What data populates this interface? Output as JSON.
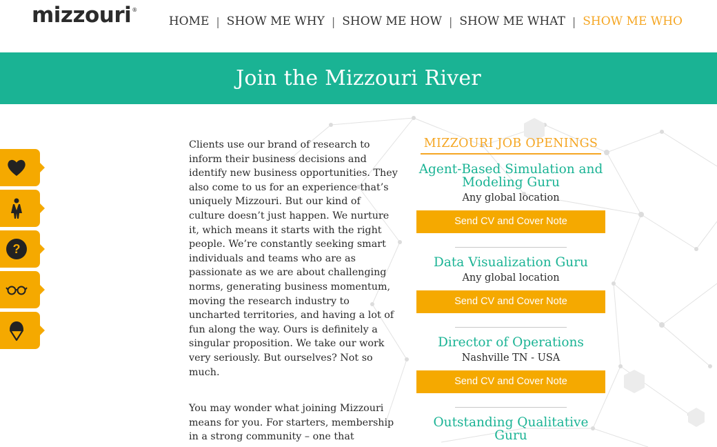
{
  "header": {
    "logo_text": "mizzouri",
    "logo_mark": "®",
    "nav": [
      {
        "label": "HOME",
        "active": false
      },
      {
        "label": "SHOW ME WHY",
        "active": false
      },
      {
        "label": "SHOW ME HOW",
        "active": false
      },
      {
        "label": "SHOW ME WHAT",
        "active": false
      },
      {
        "label": "SHOW ME WHO",
        "active": true
      }
    ],
    "separator": "|"
  },
  "banner": {
    "title": "Join the Mizzouri River"
  },
  "side_tabs": [
    {
      "icon": "heart-icon"
    },
    {
      "icon": "person-icon"
    },
    {
      "icon": "question-icon"
    },
    {
      "icon": "glasses-icon"
    },
    {
      "icon": "icecream-icon"
    }
  ],
  "intro": {
    "paragraph_1": "Clients use our brand of research to inform their business decisions and identify new business opportunities. They also come to us for an experience that’s uniquely Mizzouri. But our kind of culture doesn’t just happen. We nurture it, which means it starts with the right people. We’re constantly seeking smart individuals and teams who are as passionate as we are about challenging norms, generating business momentum, moving the research industry to uncharted territories, and having a lot of fun along the way. Ours is definitely a singular proposition.  We take our work very seriously. But ourselves? Not so much.",
    "paragraph_2": "You may wonder what joining Mizzouri means for you.  For starters, membership in a strong community – one that"
  },
  "jobs": {
    "heading": "MIZZOURI JOB OPENINGS",
    "items": [
      {
        "title": "Agent-Based Simulation and Modeling Guru",
        "location": "Any global location",
        "button": "Send CV and Cover Note"
      },
      {
        "title": "Data Visualization Guru",
        "location": "Any global location",
        "button": "Send CV and Cover Note"
      },
      {
        "title": "Director of Operations",
        "location": "Nashville TN - USA",
        "button": "Send CV and Cover Note"
      },
      {
        "title": "Outstanding Qualitative Guru",
        "location": "",
        "button": ""
      }
    ]
  },
  "colors": {
    "teal": "#1ab394",
    "orange": "#f5a900",
    "nav_active": "#f5a623"
  }
}
